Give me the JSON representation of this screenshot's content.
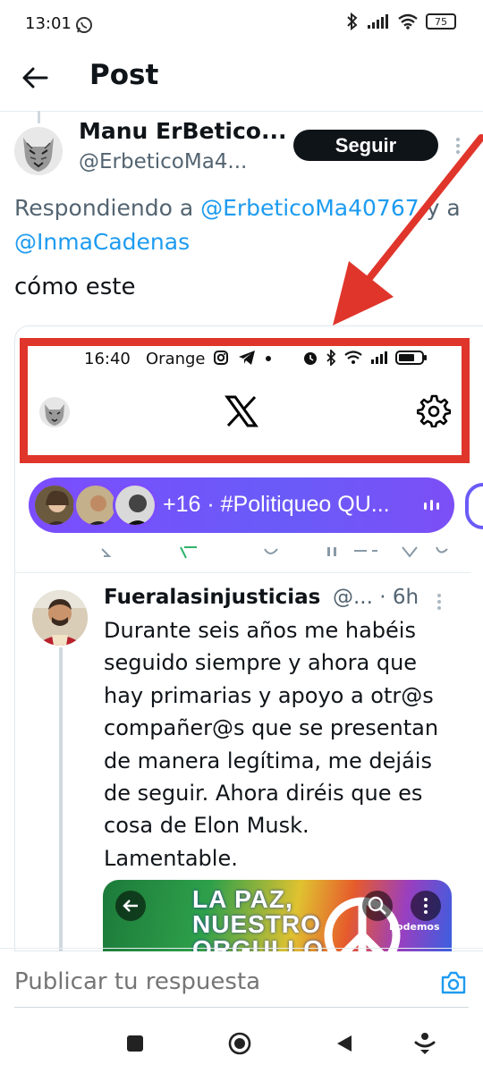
{
  "status_bar": {
    "time": "13:01",
    "battery": "75"
  },
  "header": {
    "title": "Post"
  },
  "tweet": {
    "author_name": "Manu ErBetico...",
    "author_handle": "@ErbeticoMa4...",
    "follow_label": "Seguir",
    "reply_prefix": "Respondiendo a ",
    "reply_to_1": "@ErbeticoMa40767",
    "reply_and": " y a",
    "reply_to_2": "@InmaCadenas",
    "text": "cómo este"
  },
  "embedded": {
    "status_time": "16:40",
    "carrier": "Orange",
    "spaces": {
      "label": "+16 · #Politiqueo QU..."
    },
    "second_tweet": {
      "name": "Fueralasinjusticias",
      "handle_time": "@... · 6h",
      "body_lines": [
        "Durante seis años me habéis",
        "seguido siempre y ahora que",
        "hay primarias y apoyo a otr@s",
        "compañer@s que se presentan",
        "de manera legítima, me dejáis",
        "de seguir. Ahora diréis que es",
        "cosa de Elon Musk.",
        "Lamentable."
      ],
      "media_title_1": "LA PAZ,",
      "media_title_2": "NUESTRO",
      "media_title_3": "ORGULLO",
      "media_brand": "Podemos"
    }
  },
  "composer": {
    "placeholder": "Publicar tu respuesta"
  },
  "colors": {
    "accent": "#1d9bf0",
    "annotation_red": "#e0352b",
    "spaces_purple": "#7b4dfe"
  }
}
